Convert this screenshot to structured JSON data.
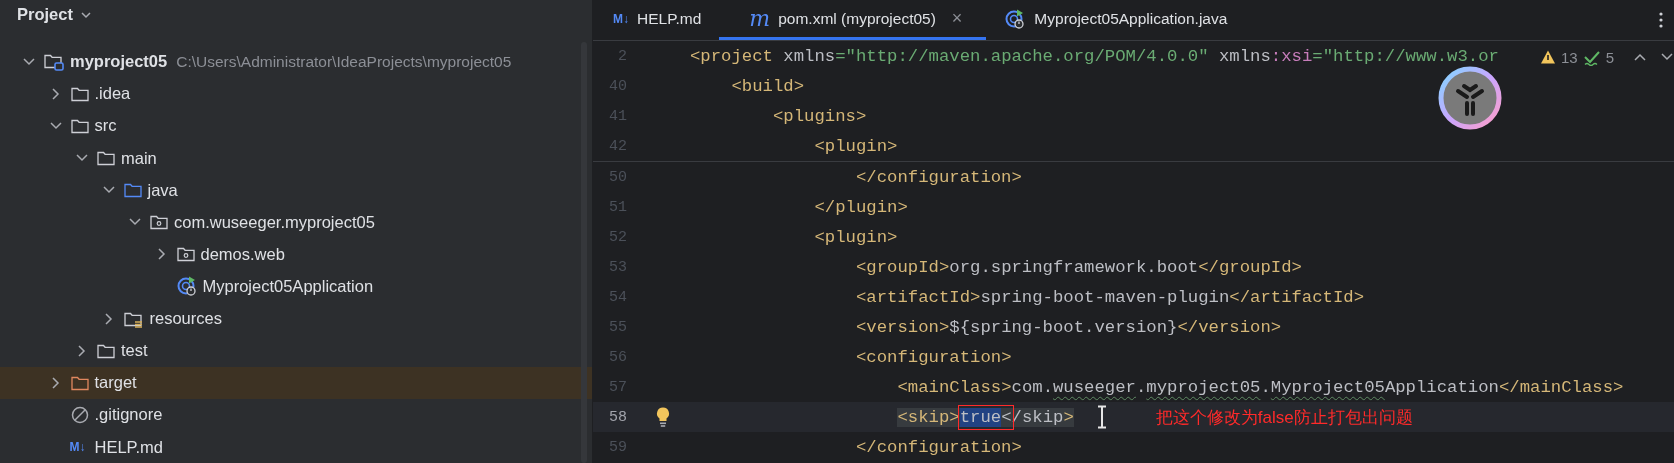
{
  "project_panel": {
    "title": "Project",
    "tree": [
      {
        "label": "myproject05",
        "path": "C:\\Users\\Administrator\\IdeaProjects\\myproject05",
        "kind": "module",
        "expanded": true,
        "selected": false,
        "children": [
          {
            "label": ".idea",
            "kind": "folder",
            "expanded": false,
            "selected": false
          },
          {
            "label": "src",
            "kind": "folder",
            "expanded": true,
            "selected": false,
            "children": [
              {
                "label": "main",
                "kind": "folder",
                "expanded": true,
                "selected": false,
                "children": [
                  {
                    "label": "java",
                    "kind": "source-folder",
                    "expanded": true,
                    "selected": false,
                    "children": [
                      {
                        "label": "com.wuseeger.myproject05",
                        "kind": "package",
                        "expanded": true,
                        "selected": false,
                        "children": [
                          {
                            "label": "demos.web",
                            "kind": "package",
                            "expanded": false,
                            "selected": false
                          },
                          {
                            "label": "Myproject05Application",
                            "kind": "spring-class",
                            "selected": false
                          }
                        ]
                      }
                    ]
                  },
                  {
                    "label": "resources",
                    "kind": "resource-folder",
                    "expanded": false,
                    "selected": false
                  }
                ]
              },
              {
                "label": "test",
                "kind": "folder",
                "expanded": false,
                "selected": false
              }
            ]
          },
          {
            "label": "target",
            "kind": "excluded-folder",
            "expanded": false,
            "selected": true
          },
          {
            "label": ".gitignore",
            "kind": "ignore-file",
            "selected": false
          },
          {
            "label": "HELP.md",
            "kind": "markdown",
            "icon_text": "M↓",
            "selected": false
          }
        ]
      }
    ]
  },
  "editor": {
    "tabs": [
      {
        "kind": "markdown",
        "icon_text": "M↓",
        "label": "HELP.md",
        "selected": false
      },
      {
        "kind": "maven",
        "icon_text": "m",
        "label": "pom.xml (myproject05)",
        "selected": true,
        "close": "×"
      },
      {
        "kind": "spring-class",
        "label": "Myproject05Application.java",
        "selected": false
      }
    ],
    "inspections": {
      "warnings": "13",
      "checks": "5"
    },
    "sticky_lines": [
      {
        "number": "2",
        "parts": [
          {
            "text": "<project xmlns=\"http://maven.apache.org/POM/4.0.0\" xmlns:xsi=\"http://www.w3.or"
          }
        ]
      },
      {
        "number": "40",
        "parts": [
          {
            "text": "    <build>"
          }
        ]
      },
      {
        "number": "41",
        "parts": [
          {
            "text": "        <plugins>"
          }
        ]
      },
      {
        "number": "42",
        "parts": [
          {
            "text": "            <plugin>"
          }
        ]
      }
    ],
    "lines": [
      {
        "number": "50",
        "current": false,
        "parts": [
          {
            "text": "                </configuration>"
          }
        ]
      },
      {
        "number": "51",
        "current": false,
        "parts": [
          {
            "text": "            </plugin>"
          }
        ]
      },
      {
        "number": "52",
        "current": false,
        "parts": [
          {
            "text": "            <plugin>"
          }
        ]
      },
      {
        "number": "53",
        "current": false,
        "parts": [
          {
            "text": "                <groupId>org.springframework.boot</groupId>"
          }
        ]
      },
      {
        "number": "54",
        "current": false,
        "parts": [
          {
            "text": "                <artifactId>spring-boot-maven-plugin</artifactId>"
          }
        ]
      },
      {
        "number": "55",
        "current": false,
        "parts": [
          {
            "text": "                <version>${spring-boot.version}</version>"
          }
        ]
      },
      {
        "number": "56",
        "current": false,
        "parts": [
          {
            "text": "                <configuration>"
          }
        ]
      },
      {
        "number": "57",
        "current": false,
        "parts": [
          {
            "text": "                    <mainClass>com."
          },
          {
            "text": "wuseeger",
            "typo": true
          },
          {
            "text": "."
          },
          {
            "text": "myproject05",
            "typo": true
          },
          {
            "text": "."
          },
          {
            "text": "Myproject05",
            "typo": true
          },
          {
            "text": "Application</mainClass>"
          }
        ]
      },
      {
        "number": "58",
        "current": true,
        "intention": true,
        "parts": [
          {
            "text": "                    <skip>",
            "matched": true
          },
          {
            "text": "true",
            "selected": true,
            "boxed": true
          },
          {
            "text": "<",
            "matched": true,
            "boxed": true
          },
          {
            "text": "/skip>",
            "matched": true
          }
        ],
        "note": "把这个修改为false防止打包出问题"
      },
      {
        "number": "59",
        "current": false,
        "parts": [
          {
            "text": "                </configuration>"
          }
        ]
      }
    ]
  }
}
